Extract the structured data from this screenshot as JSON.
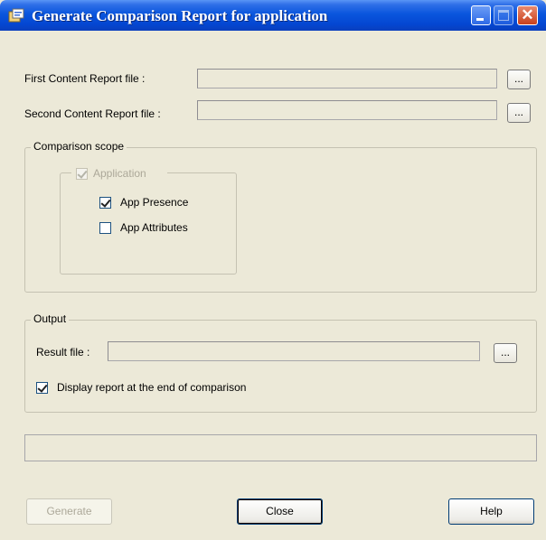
{
  "window": {
    "title": "Generate Comparison Report for application",
    "icons": {
      "app": "report-icon",
      "minimize": "minimize-icon",
      "maximize": "maximize-icon",
      "close": "close-icon"
    }
  },
  "files": {
    "first_label": "First Content Report file :",
    "first_value": "",
    "second_label": "Second Content Report file :",
    "second_value": "",
    "browse_label": "..."
  },
  "scope": {
    "legend": "Comparison scope",
    "application": {
      "label": "Application",
      "checked": true,
      "enabled": false
    },
    "app_presence": {
      "label": "App Presence",
      "checked": true
    },
    "app_attributes": {
      "label": "App Attributes",
      "checked": false
    }
  },
  "output": {
    "legend": "Output",
    "result_label": "Result file :",
    "result_value": "",
    "browse_label": "...",
    "display_report": {
      "label": "Display report at the end of comparison",
      "checked": true
    }
  },
  "status_text": "",
  "buttons": {
    "generate": "Generate",
    "close": "Close",
    "help": "Help"
  }
}
